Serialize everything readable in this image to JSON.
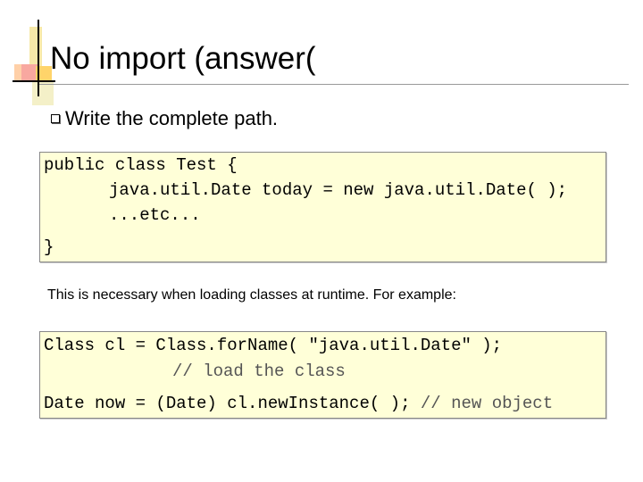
{
  "slide": {
    "title": "No import (answer(",
    "bullet": "Write the complete path.",
    "code1": {
      "line1": "public class Test {",
      "line2": "java.util.Date today = new java.util.Date( );",
      "line3": "...etc...",
      "line4": "}"
    },
    "note": "This is necessary when loading classes at runtime.  For example:",
    "code2": {
      "line1": "Class cl = Class.forName( \"java.util.Date\" );",
      "line2_comment": "// load the class",
      "line3_code": "Date now = (Date) cl.newInstance( ); ",
      "line3_comment": "// new object"
    }
  },
  "colors": {
    "code_background": "#ffffd8",
    "comment": "#555555"
  }
}
